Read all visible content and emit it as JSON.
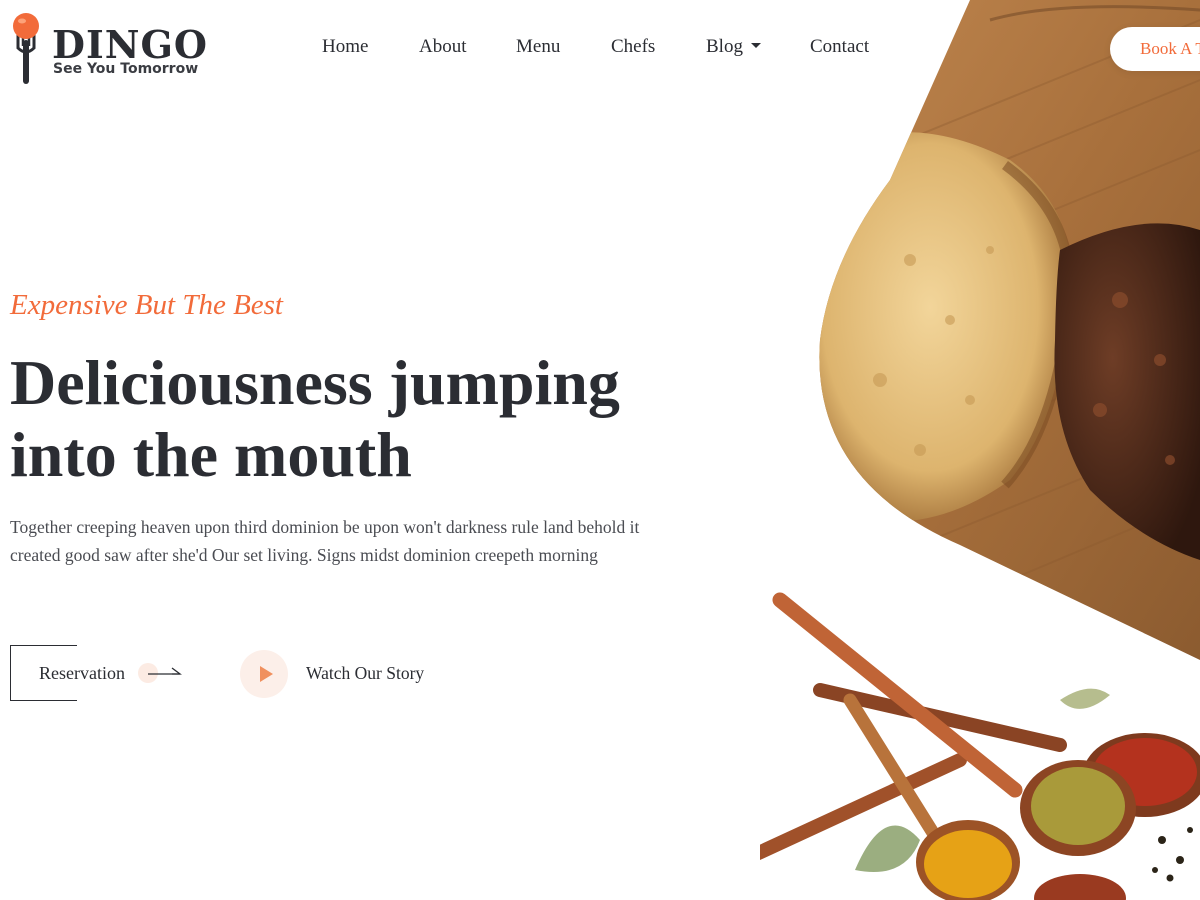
{
  "brand": {
    "name": "DINGO",
    "tagline": "See You Tomorrow"
  },
  "nav": {
    "items": [
      "Home",
      "About",
      "Menu",
      "Chefs",
      "Blog",
      "Contact"
    ],
    "book_label": "Book A T"
  },
  "hero": {
    "eyebrow": "Expensive But The Best",
    "headline_line1": "Deliciousness jumping",
    "headline_line2": "into the mouth",
    "description": "Together creeping heaven upon third dominion be upon won't darkness rule land behold it created good saw after she'd Our set living. Signs midst dominion creepeth morning",
    "reservation_label": "Reservation",
    "story_label": "Watch Our Story"
  },
  "colors": {
    "accent": "#f26b3a",
    "text": "#2b2d33",
    "wood": "#b8814a",
    "play_bg": "#fcefe9"
  },
  "icons": {
    "play": "play-icon",
    "arrow": "arrow-right-icon",
    "caret": "chevron-down-icon"
  }
}
